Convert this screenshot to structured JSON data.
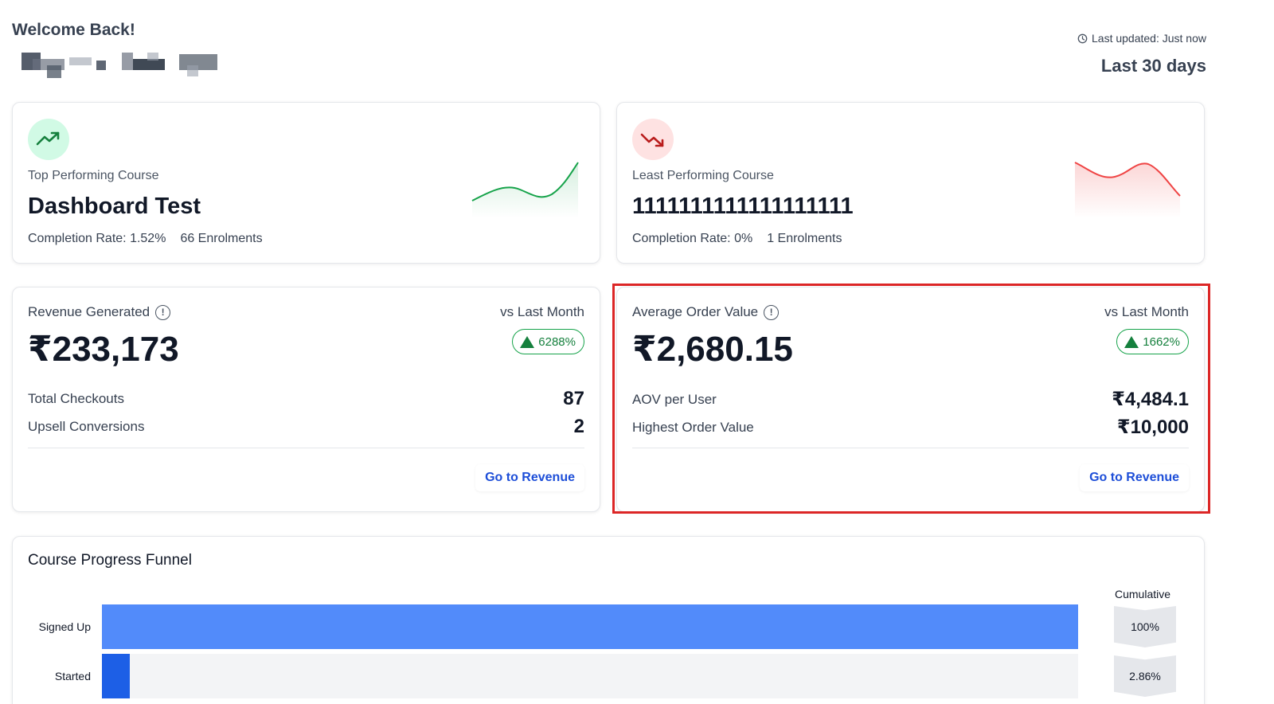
{
  "header": {
    "welcome": "Welcome Back!",
    "last_updated": "Last updated: Just now",
    "range": "Last 30 days"
  },
  "top_course": {
    "label": "Top Performing Course",
    "name": "Dashboard Test",
    "completion_rate": "Completion Rate: 1.52%",
    "enrolments": "66 Enrolments",
    "trend_color": "#16a34a"
  },
  "least_course": {
    "label": "Least Performing Course",
    "name": "1111111111111111111",
    "completion_rate": "Completion Rate: 0%",
    "enrolments": "1 Enrolments",
    "trend_color": "#ef4444"
  },
  "revenue": {
    "label": "Revenue Generated",
    "vs": "vs Last Month",
    "change": "6288%",
    "value": "₹233,173",
    "rows": [
      {
        "key": "Total Checkouts",
        "value": "87"
      },
      {
        "key": "Upsell Conversions",
        "value": "2"
      }
    ],
    "link": "Go to Revenue"
  },
  "aov": {
    "label": "Average Order Value",
    "vs": "vs Last Month",
    "change": "1662%",
    "value": "₹2,680.15",
    "rows": [
      {
        "key": "AOV per User",
        "value": "₹4,484.1"
      },
      {
        "key": "Highest Order Value",
        "value": "₹10,000"
      }
    ],
    "link": "Go to Revenue"
  },
  "funnel": {
    "title": "Course Progress Funnel",
    "cumulative_header": "Cumulative",
    "stages": [
      {
        "label": "Signed Up",
        "fraction": 1.0,
        "cumulative": "100%"
      },
      {
        "label": "Started",
        "fraction": 0.0286,
        "cumulative": "2.86%"
      }
    ]
  },
  "colors": {
    "accent_blue": "#1d4ed8",
    "success_green": "#16a34a",
    "highlight_red": "#dc2626",
    "funnel_blue": "#528bfa"
  }
}
